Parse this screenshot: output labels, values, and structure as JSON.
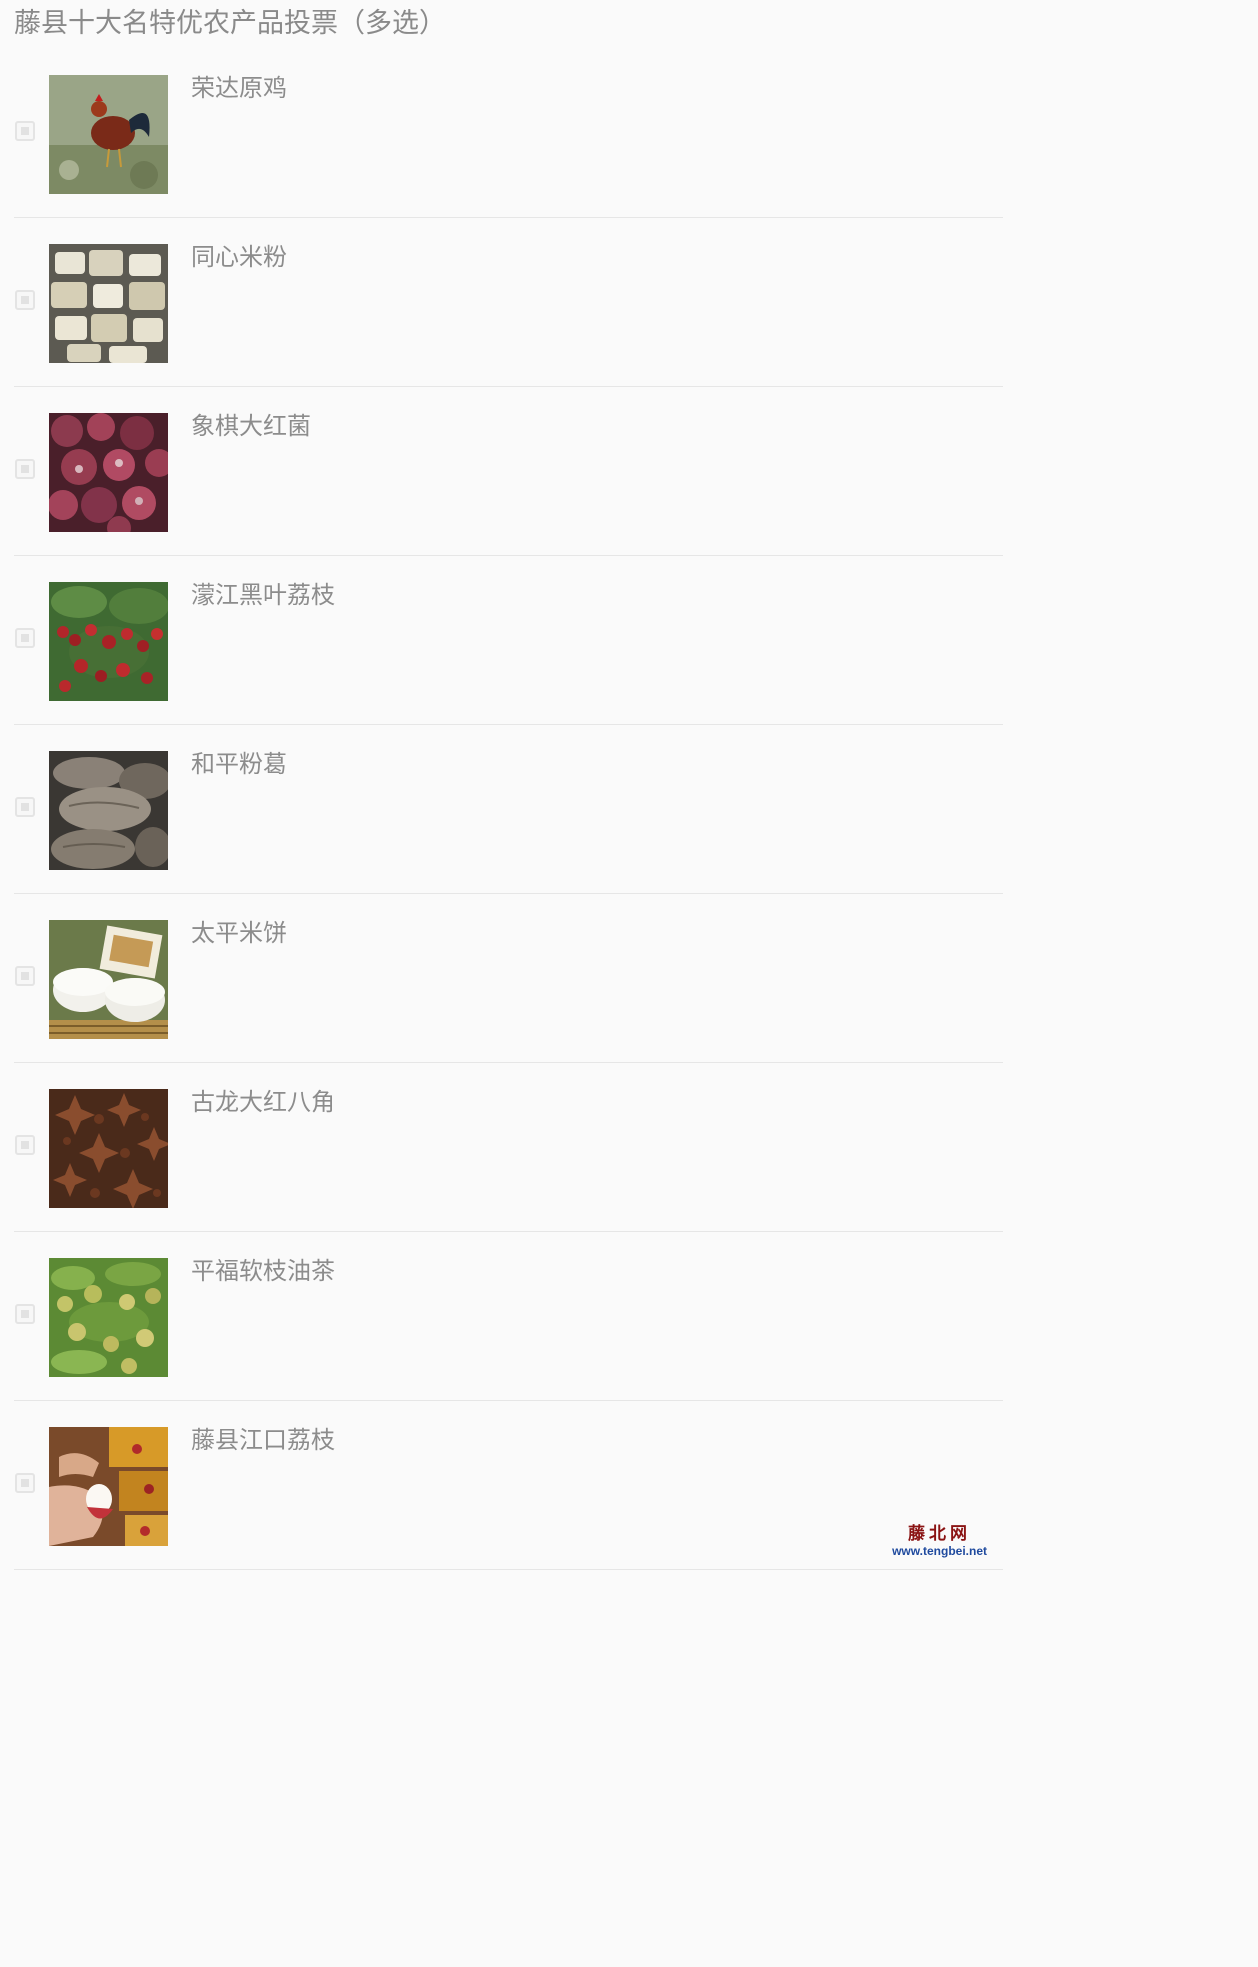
{
  "title": "藤县十大名特优农产品投票（多选）",
  "options": [
    {
      "label": "荣达原鸡",
      "image": "rooster-photo",
      "checked": false
    },
    {
      "label": "同心米粉",
      "image": "rice-noodle-photo",
      "checked": false
    },
    {
      "label": "象棋大红菌",
      "image": "red-mushroom-photo",
      "checked": false
    },
    {
      "label": "濛江黑叶荔枝",
      "image": "lychee-tree-photo",
      "checked": false
    },
    {
      "label": "和平粉葛",
      "image": "kudzu-root-photo",
      "checked": false
    },
    {
      "label": "太平米饼",
      "image": "rice-cake-photo",
      "checked": false
    },
    {
      "label": "古龙大红八角",
      "image": "star-anise-photo",
      "checked": false
    },
    {
      "label": "平福软枝油茶",
      "image": "camellia-fruit-photo",
      "checked": false
    },
    {
      "label": "藤县江口荔枝",
      "image": "peeled-lychee-photo",
      "checked": false
    }
  ],
  "watermark": {
    "name": "藤北网",
    "url": "www.tengbei.net"
  },
  "colors": {
    "background": "#fafafa",
    "text": "#8c8c8c",
    "divider": "#e6e6e6",
    "watermark_name": "#8a1313",
    "watermark_url": "#1f4a9e"
  }
}
